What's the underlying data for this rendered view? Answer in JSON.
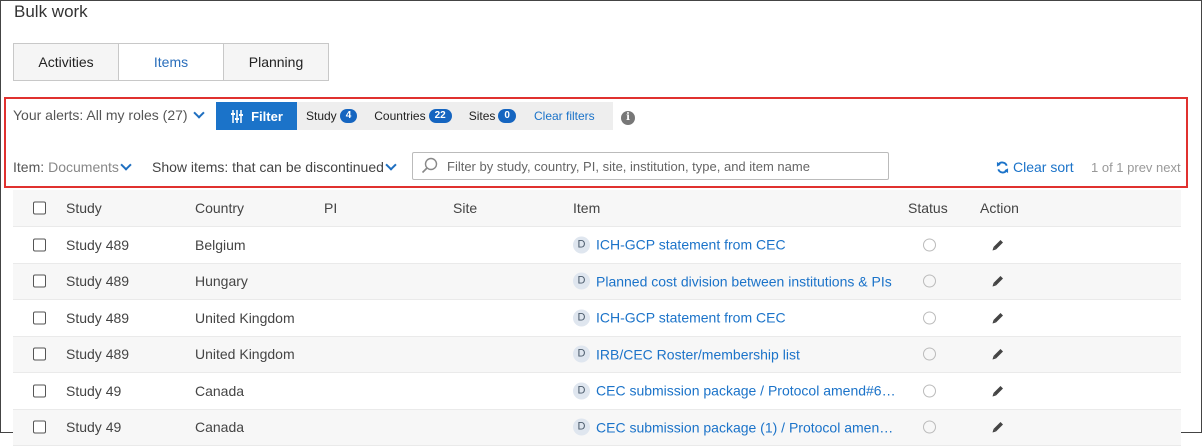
{
  "page": {
    "title": "Bulk work"
  },
  "tabs": [
    {
      "label": "Activities",
      "active": false
    },
    {
      "label": "Items",
      "active": true
    },
    {
      "label": "Planning",
      "active": false
    }
  ],
  "alerts": {
    "label": "Your alerts: All my roles (27)"
  },
  "filter": {
    "button_label": "Filter",
    "chips": [
      {
        "label": "Study",
        "count": "4"
      },
      {
        "label": "Countries",
        "count": "22"
      },
      {
        "label": "Sites",
        "count": "0"
      }
    ],
    "clear_label": "Clear filters",
    "info_icon": "i"
  },
  "item_type": {
    "label": "Item:",
    "value": "Documents"
  },
  "show_items": {
    "label": "Show items: that can be discontinued"
  },
  "search": {
    "placeholder": "Filter by study, country, PI, site, institution, type, and item name"
  },
  "clear_sort": {
    "label": "Clear sort"
  },
  "pagination": {
    "label": "1 of 1 prev next"
  },
  "table": {
    "headers": {
      "study": "Study",
      "country": "Country",
      "pi": "PI",
      "site": "Site",
      "item": "Item",
      "status": "Status",
      "action": "Action"
    },
    "rows": [
      {
        "study": "Study 489",
        "country": "Belgium",
        "pi": "",
        "site": "",
        "item_type": "D",
        "item": "ICH-GCP statement from CEC"
      },
      {
        "study": "Study 489",
        "country": "Hungary",
        "pi": "",
        "site": "",
        "item_type": "D",
        "item": "Planned cost division between institutions & PIs"
      },
      {
        "study": "Study 489",
        "country": "United Kingdom",
        "pi": "",
        "site": "",
        "item_type": "D",
        "item": "ICH-GCP statement from CEC"
      },
      {
        "study": "Study 489",
        "country": "United Kingdom",
        "pi": "",
        "site": "",
        "item_type": "D",
        "item": "IRB/CEC Roster/membership list"
      },
      {
        "study": "Study 49",
        "country": "Canada",
        "pi": "",
        "site": "",
        "item_type": "D",
        "item": "CEC submission package / Protocol amend#6_…"
      },
      {
        "study": "Study 49",
        "country": "Canada",
        "pi": "",
        "site": "",
        "item_type": "D",
        "item": "CEC submission package (1) / Protocol amend#…"
      }
    ]
  },
  "colors": {
    "accent": "#1b73c9",
    "highlight": "#e0312f"
  }
}
